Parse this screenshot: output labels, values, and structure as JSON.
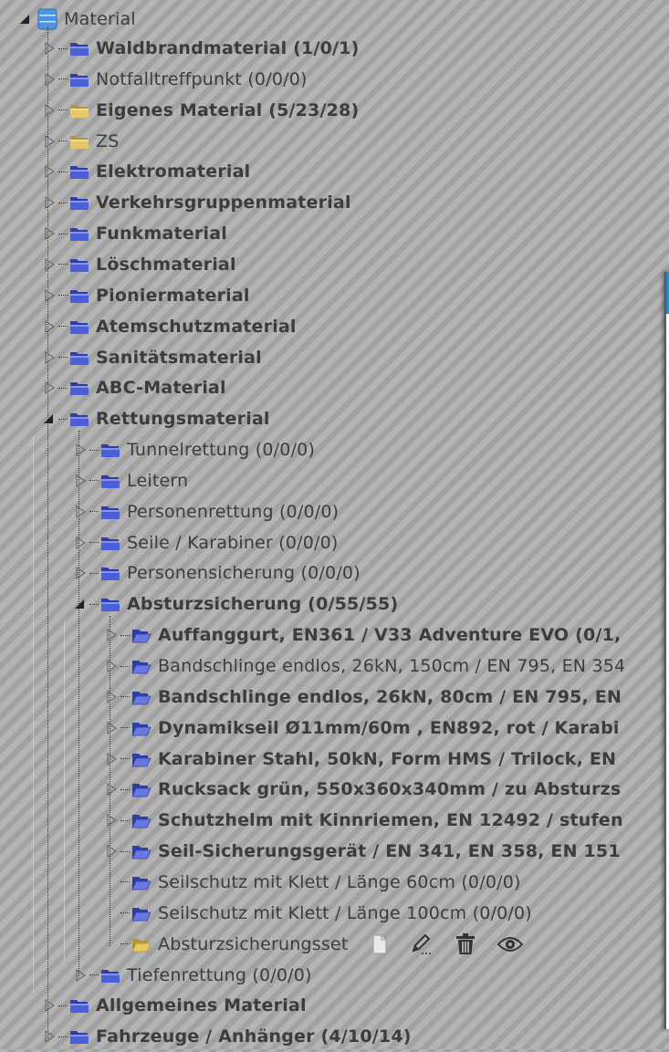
{
  "tree": {
    "root": {
      "label": "Material"
    },
    "items": [
      {
        "label": "Waldbrandmaterial (1/0/1)",
        "bold": true,
        "icon": "folder-blue"
      },
      {
        "label": "Notfalltreffpunkt (0/0/0)",
        "bold": false,
        "icon": "folder-blue"
      },
      {
        "label": "Eigenes Material (5/23/28)",
        "bold": true,
        "icon": "folder-yellow"
      },
      {
        "label": "ZS",
        "bold": false,
        "icon": "folder-yellow"
      },
      {
        "label": "Elektromaterial",
        "bold": true,
        "icon": "folder-blue"
      },
      {
        "label": "Verkehrsgruppenmaterial",
        "bold": true,
        "icon": "folder-blue"
      },
      {
        "label": "Funkmaterial",
        "bold": true,
        "icon": "folder-blue"
      },
      {
        "label": "Löschmaterial",
        "bold": true,
        "icon": "folder-blue"
      },
      {
        "label": "Pioniermaterial",
        "bold": true,
        "icon": "folder-blue"
      },
      {
        "label": "Atemschutzmaterial",
        "bold": true,
        "icon": "folder-blue"
      },
      {
        "label": "Sanitätsmaterial",
        "bold": true,
        "icon": "folder-blue"
      },
      {
        "label": "ABC-Material",
        "bold": true,
        "icon": "folder-blue"
      },
      {
        "label": "Rettungsmaterial",
        "bold": true,
        "icon": "folder-blue",
        "expanded": true
      },
      {
        "label": "Tunnelrettung (0/0/0)",
        "bold": false,
        "icon": "folder-blue"
      },
      {
        "label": "Leitern",
        "bold": false,
        "icon": "folder-blue"
      },
      {
        "label": "Personenrettung (0/0/0)",
        "bold": false,
        "icon": "folder-blue"
      },
      {
        "label": "Seile / Karabiner (0/0/0)",
        "bold": false,
        "icon": "folder-blue"
      },
      {
        "label": "Personensicherung (0/0/0)",
        "bold": false,
        "icon": "folder-blue"
      },
      {
        "label": "Absturzsicherung (0/55/55)",
        "bold": true,
        "icon": "folder-blue",
        "expanded": true
      },
      {
        "label": "Auffanggurt, EN361 / V33 Adventure EVO (0/1,",
        "bold": true,
        "icon": "folder-blue-open"
      },
      {
        "label": "Bandschlinge endlos, 26kN, 150cm / EN 795, EN 354",
        "bold": false,
        "icon": "folder-blue-open"
      },
      {
        "label": "Bandschlinge endlos, 26kN, 80cm / EN 795, EN",
        "bold": true,
        "icon": "folder-blue-open"
      },
      {
        "label": "Dynamikseil Ø11mm/60m , EN892, rot / Karabi",
        "bold": true,
        "icon": "folder-blue-open"
      },
      {
        "label": "Karabiner Stahl, 50kN, Form HMS / Trilock, EN",
        "bold": true,
        "icon": "folder-blue-open"
      },
      {
        "label": "Rucksack grün, 550x360x340mm / zu Absturzs",
        "bold": true,
        "icon": "folder-blue-open"
      },
      {
        "label": "Schutzhelm mit Kinnriemen, EN 12492 / stufen",
        "bold": true,
        "icon": "folder-blue-open"
      },
      {
        "label": "Seil-Sicherungsgerät / EN 341, EN 358, EN 151",
        "bold": true,
        "icon": "folder-blue-open"
      },
      {
        "label": "Seilschutz mit Klett / Länge 60cm (0/0/0)",
        "bold": false,
        "icon": "folder-blue-open"
      },
      {
        "label": "Seilschutz mit Klett / Länge 100cm (0/0/0)",
        "bold": false,
        "icon": "folder-blue-open"
      },
      {
        "label": "Absturzsicherungsset",
        "bold": false,
        "icon": "folder-yellow-open",
        "actions": [
          "new-document-icon",
          "edit-pencil-icon",
          "trash-icon",
          "eye-icon"
        ]
      },
      {
        "label": "Tiefenrettung (0/0/0)",
        "bold": false,
        "icon": "folder-blue"
      },
      {
        "label": "Allgemeines Material",
        "bold": true,
        "icon": "folder-blue"
      },
      {
        "label": "Fahrzeuge / Anhänger (4/10/14)",
        "bold": true,
        "icon": "folder-blue"
      }
    ]
  },
  "colors": {
    "folder_blue": "#4a5fd8",
    "folder_yellow": "#e8c766",
    "folder_open_blue": "#6878e0",
    "panel_accent": "#2b88c7"
  }
}
